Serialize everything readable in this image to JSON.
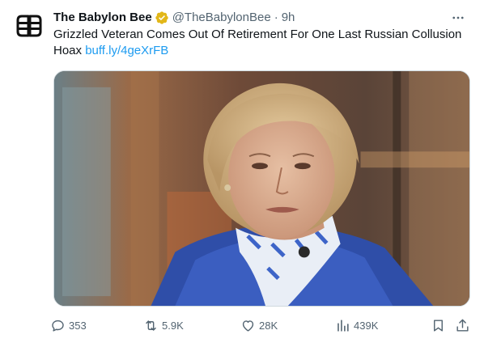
{
  "tweet": {
    "display_name": "The Babylon Bee",
    "handle": "@TheBabylonBee",
    "separator": "·",
    "time": "9h",
    "text": "Grizzled Veteran Comes Out Of Retirement For One Last Russian Collusion Hoax",
    "link": "buff.ly/4geXrFB",
    "verified": true,
    "verified_color": "#e2b719"
  },
  "actions": {
    "reply_count": "353",
    "retweet_count": "5.9K",
    "like_count": "28K",
    "views_count": "439K"
  },
  "icons": {
    "avatar": "bee-logo-icon",
    "more": "more-horizontal-icon",
    "reply": "reply-icon",
    "retweet": "retweet-icon",
    "like": "heart-icon",
    "views": "analytics-icon",
    "bookmark": "bookmark-icon",
    "share": "share-icon"
  },
  "colors": {
    "link": "#1d9bf0",
    "muted": "#536471",
    "text": "#0f1419"
  }
}
